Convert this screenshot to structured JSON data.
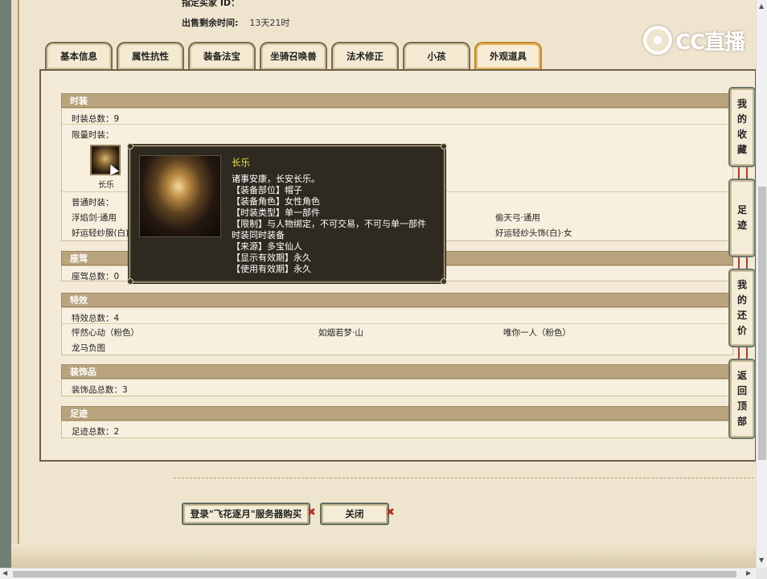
{
  "header": {
    "buyer_label": "指定买家 ID：",
    "time_label": "出售剩余时间:",
    "time_value": "13天21时"
  },
  "watermark": {
    "text": "CC直播",
    "icon": "cc-logo-icon"
  },
  "tabs": [
    {
      "label": "基本信息",
      "active": false
    },
    {
      "label": "属性抗性",
      "active": false
    },
    {
      "label": "装备法宝",
      "active": false
    },
    {
      "label": "坐骑召唤兽",
      "active": false
    },
    {
      "label": "法术修正",
      "active": false
    },
    {
      "label": "小孩",
      "active": false
    },
    {
      "label": "外观道具",
      "active": true
    }
  ],
  "sections": {
    "fashion": {
      "title": "时装",
      "total": "时装总数：9",
      "limited_label": "限量时装：",
      "limited_item": "长乐",
      "normal_label": "普通时装：",
      "normal_items": [
        "浮焰剑·通用",
        "偷天弓·通用",
        "好运轻纱服(白)·女",
        "好运轻纱头饰(白)·女"
      ]
    },
    "mount": {
      "title": "座驾",
      "total": "座驾总数：0"
    },
    "effects": {
      "title": "特效",
      "total": "特效总数：4",
      "items": [
        "怦然心动（粉色）",
        "如烟若梦·山",
        "唯你一人（粉色）",
        "龙马负图"
      ]
    },
    "accessories": {
      "title": "装饰品",
      "total": "装饰品总数：3"
    },
    "footprints": {
      "title": "足迹",
      "total": "足迹总数：2"
    }
  },
  "tooltip": {
    "title": "长乐",
    "lines": [
      "诸事安康，长安长乐。",
      "【装备部位】帽子",
      "【装备角色】女性角色",
      "【时装类型】单一部件",
      "【限制】与人物绑定，不可交易，不可与单一部件",
      "时装同时装备",
      "【来源】多宝仙人",
      "【显示有效期】永久",
      "【使用有效期】永久"
    ]
  },
  "side_buttons": [
    {
      "label": [
        "我",
        "的",
        "收",
        "藏"
      ]
    },
    {
      "label": [
        "足",
        "迹"
      ]
    },
    {
      "label": [
        "我",
        "的",
        "还",
        "价"
      ]
    },
    {
      "label": [
        "返",
        "回",
        "顶",
        "部"
      ]
    }
  ],
  "buttons": {
    "buy": "登录\"飞花逐月\"服务器购买",
    "close": "关闭",
    "x_mark": "✖"
  },
  "scroll_arrows": {
    "up": "▲",
    "down": "▼",
    "left": "◀",
    "right": "▶"
  },
  "colors": {
    "section_header": "#b9a47e",
    "tooltip_bg": "#2e2a20",
    "tooltip_title": "#f2e24a",
    "active_tab_border": "#c08a2a"
  }
}
